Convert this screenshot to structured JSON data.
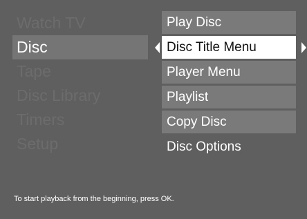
{
  "left_menu": {
    "items": [
      {
        "label": "Watch TV"
      },
      {
        "label": "Disc"
      },
      {
        "label": "Tape"
      },
      {
        "label": "Disc Library"
      },
      {
        "label": "Timers"
      },
      {
        "label": "Setup"
      }
    ],
    "selected_index": 1
  },
  "right_menu": {
    "items": [
      {
        "label": "Play Disc"
      },
      {
        "label": "Disc Title Menu"
      },
      {
        "label": "Player Menu"
      },
      {
        "label": "Playlist"
      },
      {
        "label": "Copy Disc"
      },
      {
        "label": "Disc Options"
      }
    ],
    "selected_index": 1
  },
  "help_text": "To start playback from the beginning, press OK.",
  "colors": {
    "background": "#5f5f5f",
    "left_selected_bg": "#757575",
    "left_inactive_text": "#6c6c6c",
    "right_item_bg": "#7a7a7a",
    "right_selected_bg": "#ffffff",
    "right_selected_text": "#111111",
    "text": "#ffffff"
  },
  "icons": {
    "left_arrow": "left-arrow-icon",
    "right_arrow": "right-arrow-icon"
  }
}
